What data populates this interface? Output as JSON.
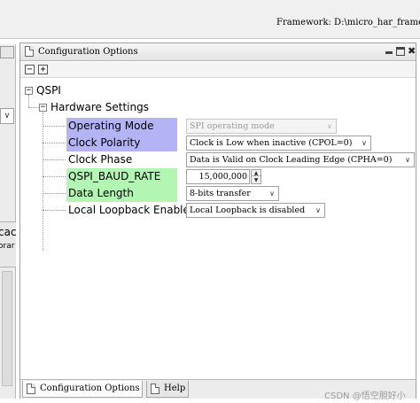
{
  "framework": {
    "label": "Framework: D:\\micro_har_framewo"
  },
  "left_panel": {
    "truncated_line1": "cac",
    "truncated_line2": "orar",
    "dropdown_glyph": "∨"
  },
  "panel": {
    "title": "Configuration Options",
    "minimize_glyph": "▂",
    "close_glyph": "✖",
    "toolbar": {
      "collapse_glyph": "−",
      "expand_glyph": "+"
    }
  },
  "tree": {
    "root": {
      "label": "QSPI",
      "toggle": "−"
    },
    "group": {
      "label": "Hardware Settings",
      "toggle": "−"
    },
    "properties": [
      {
        "name": "Operating Mode",
        "value": "SPI operating mode",
        "control": "dropdown",
        "enabled": false,
        "highlight": "#b3b3f5"
      },
      {
        "name": "Clock Polarity",
        "value": "Clock is Low when inactive (CPOL=0)",
        "control": "dropdown",
        "enabled": true,
        "highlight": "#b3b3f5"
      },
      {
        "name": "Clock Phase",
        "value": "Data is Valid on Clock Leading Edge (CPHA=0)",
        "control": "dropdown",
        "enabled": true,
        "highlight": ""
      },
      {
        "name": "QSPI_BAUD_RATE",
        "value": "15,000,000",
        "control": "spinner",
        "enabled": true,
        "highlight": "#b3f5b3"
      },
      {
        "name": "Data Length",
        "value": "8-bits transfer",
        "control": "dropdown",
        "enabled": true,
        "highlight": "#b3f5b3"
      },
      {
        "name": "Local Loopback Enable",
        "value": "Local Loopback is disabled",
        "control": "dropdown",
        "enabled": true,
        "highlight": ""
      }
    ],
    "dropdown_glyph": "∨",
    "spin_up_glyph": "▲",
    "spin_down_glyph": "▼"
  },
  "bottom_tabs": [
    {
      "label": "Configuration Options",
      "active": true
    },
    {
      "label": "Help",
      "active": false
    }
  ],
  "watermark": "CSDN @悟空胆好小"
}
